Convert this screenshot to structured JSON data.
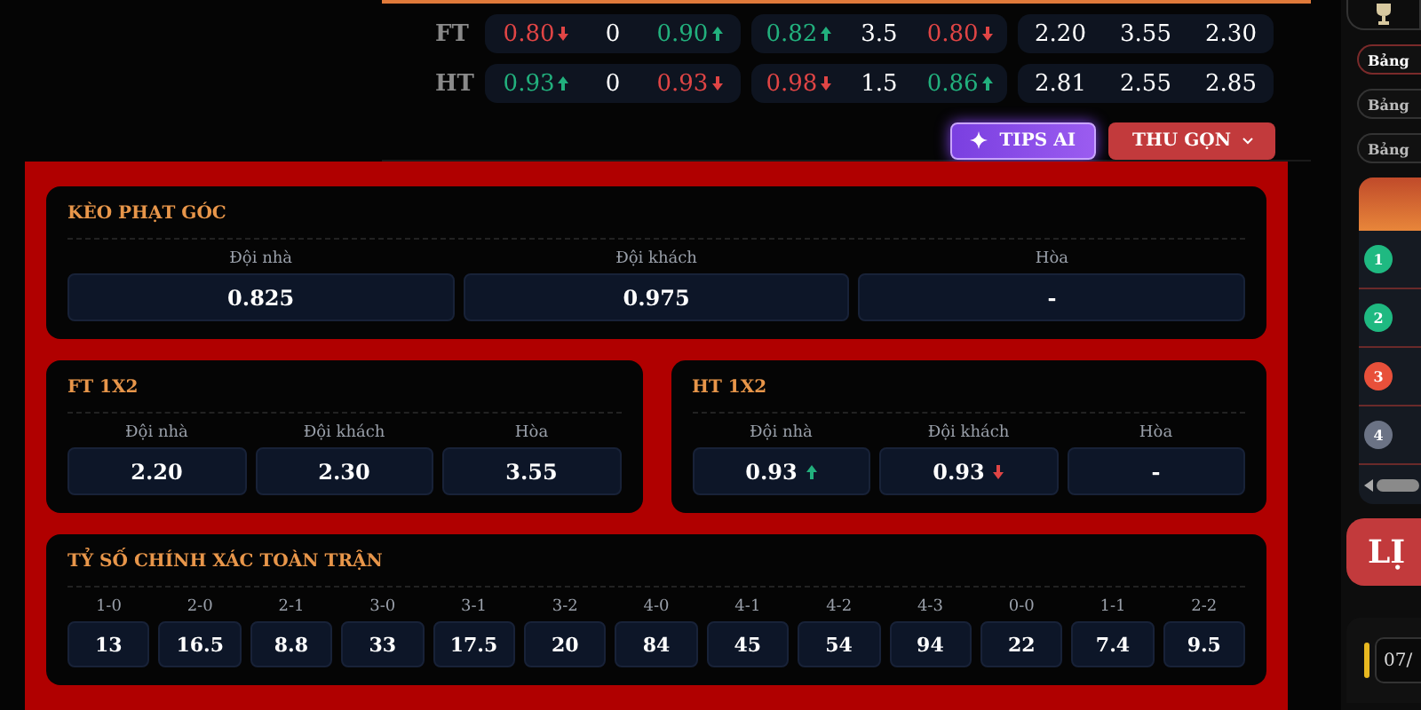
{
  "odds_rows": [
    {
      "label": "FT",
      "groups": [
        [
          {
            "text": "0.80",
            "up": false,
            "down": true
          },
          {
            "text": "0",
            "up": false,
            "down": false
          },
          {
            "text": "0.90",
            "up": true,
            "down": false
          }
        ],
        [
          {
            "text": "0.82",
            "up": true,
            "down": false
          },
          {
            "text": "3.5",
            "up": false,
            "down": false
          },
          {
            "text": "0.80",
            "up": false,
            "down": true
          }
        ],
        [
          {
            "text": "2.20",
            "up": false,
            "down": false
          },
          {
            "text": "3.55",
            "up": false,
            "down": false
          },
          {
            "text": "2.30",
            "up": false,
            "down": false
          }
        ]
      ]
    },
    {
      "label": "HT",
      "groups": [
        [
          {
            "text": "0.93",
            "up": true,
            "down": false
          },
          {
            "text": "0",
            "up": false,
            "down": false
          },
          {
            "text": "0.93",
            "up": false,
            "down": true
          }
        ],
        [
          {
            "text": "0.98",
            "up": false,
            "down": true
          },
          {
            "text": "1.5",
            "up": false,
            "down": false
          },
          {
            "text": "0.86",
            "up": true,
            "down": false
          }
        ],
        [
          {
            "text": "2.81",
            "up": false,
            "down": false
          },
          {
            "text": "2.55",
            "up": false,
            "down": false
          },
          {
            "text": "2.85",
            "up": false,
            "down": false
          }
        ]
      ]
    }
  ],
  "buttons": [
    {
      "label": "TIPS AI",
      "kind": "tips"
    },
    {
      "label": "THU GỌN",
      "kind": "collapse"
    }
  ],
  "corner_kick": {
    "title": "KÈO PHẠT GÓC",
    "options": [
      {
        "label": "Đội nhà",
        "value": "0.825"
      },
      {
        "label": "Đội khách",
        "value": "0.975"
      },
      {
        "label": "Hòa",
        "value": "-"
      }
    ]
  },
  "ft_1x2": {
    "title": "FT 1X2",
    "options": [
      {
        "label": "Đội nhà",
        "value": "2.20"
      },
      {
        "label": "Đội khách",
        "value": "2.30"
      },
      {
        "label": "Hòa",
        "value": "3.55"
      }
    ]
  },
  "ht_1x2": {
    "title": "HT 1X2",
    "options": [
      {
        "label": "Đội nhà",
        "value": "0.93",
        "up": true,
        "down": false
      },
      {
        "label": "Đội khách",
        "value": "0.93",
        "up": false,
        "down": true
      },
      {
        "label": "Hòa",
        "value": "-",
        "up": false,
        "down": false
      }
    ]
  },
  "correct_score": {
    "title": "TỶ SỐ CHÍNH XÁC TOÀN TRẬN",
    "options": [
      {
        "label": "1-0",
        "value": "13"
      },
      {
        "label": "2-0",
        "value": "16.5"
      },
      {
        "label": "2-1",
        "value": "8.8"
      },
      {
        "label": "3-0",
        "value": "33"
      },
      {
        "label": "3-1",
        "value": "17.5"
      },
      {
        "label": "3-2",
        "value": "20"
      },
      {
        "label": "4-0",
        "value": "84"
      },
      {
        "label": "4-1",
        "value": "45"
      },
      {
        "label": "4-2",
        "value": "54"
      },
      {
        "label": "4-3",
        "value": "94"
      },
      {
        "label": "0-0",
        "value": "22"
      },
      {
        "label": "1-1",
        "value": "7.4"
      },
      {
        "label": "2-2",
        "value": "9.5"
      }
    ]
  },
  "sidebar": {
    "pills": [
      {
        "label": "Bảng",
        "selected": true
      },
      {
        "label": "Bảng",
        "selected": false
      },
      {
        "label": "Bảng",
        "selected": false
      }
    ],
    "ranking": [
      {
        "rank": "1",
        "color": "#1fb981"
      },
      {
        "rank": "2",
        "color": "#1fb981"
      },
      {
        "rank": "3",
        "color": "#e8503a"
      },
      {
        "rank": "4",
        "color": "#6b7385"
      }
    ],
    "heading": "LỊ",
    "date": "07/"
  }
}
